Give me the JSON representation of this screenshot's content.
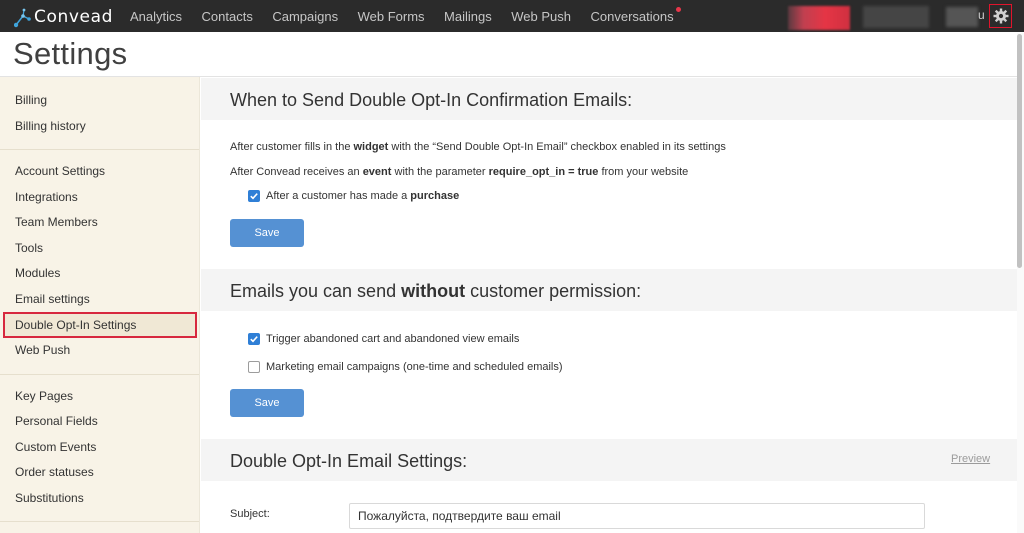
{
  "topbar": {
    "logo_text": "Convead",
    "nav": [
      "Analytics",
      "Contacts",
      "Campaigns",
      "Web Forms",
      "Mailings",
      "Web Push",
      "Conversations"
    ],
    "user_suffix": "u",
    "settings_icon": "gear-icon",
    "notification_color": "#e8364a"
  },
  "page": {
    "title": "Settings"
  },
  "sidebar": {
    "group1": [
      "Billing",
      "Billing history"
    ],
    "group2": [
      "Account Settings",
      "Integrations",
      "Team Members",
      "Tools",
      "Modules",
      "Email settings",
      "Double Opt-In Settings",
      "Web Push"
    ],
    "group3": [
      "Key Pages",
      "Personal Fields",
      "Custom Events",
      "Order statuses",
      "Substitutions"
    ],
    "active": "Double Opt-In Settings"
  },
  "section1": {
    "title": "When to Send Double Opt-In Confirmation Emails:",
    "line1": {
      "a": "After customer fills in the ",
      "b": "widget",
      "c": " with the “Send Double Opt-In Email” checkbox enabled in its settings"
    },
    "line2": {
      "a": "After Convead receives an ",
      "b": "event",
      "c": " with the parameter ",
      "d": "require_opt_in = true",
      "e": " from your website"
    },
    "checkbox": {
      "a": "After a customer has made a ",
      "b": "purchase",
      "checked": true
    },
    "save": "Save"
  },
  "section2": {
    "title_a": "Emails you can send ",
    "title_b": "without",
    "title_c": " customer permission:",
    "checkbox1": {
      "label": "Trigger abandoned cart and abandoned view emails",
      "checked": true
    },
    "checkbox2": {
      "label": "Marketing email campaigns (one-time and scheduled emails)",
      "checked": false
    },
    "save": "Save"
  },
  "section3": {
    "title": "Double Opt-In Email Settings:",
    "preview": "Preview",
    "subject_label": "Subject:",
    "subject_value": "Пожалуйста, подтвердите ваш email"
  },
  "colors": {
    "accent": "#5591d3",
    "checkbox": "#2f7fd6",
    "sidebar_bg": "#f8f3e7",
    "highlight": "#d7283e"
  }
}
